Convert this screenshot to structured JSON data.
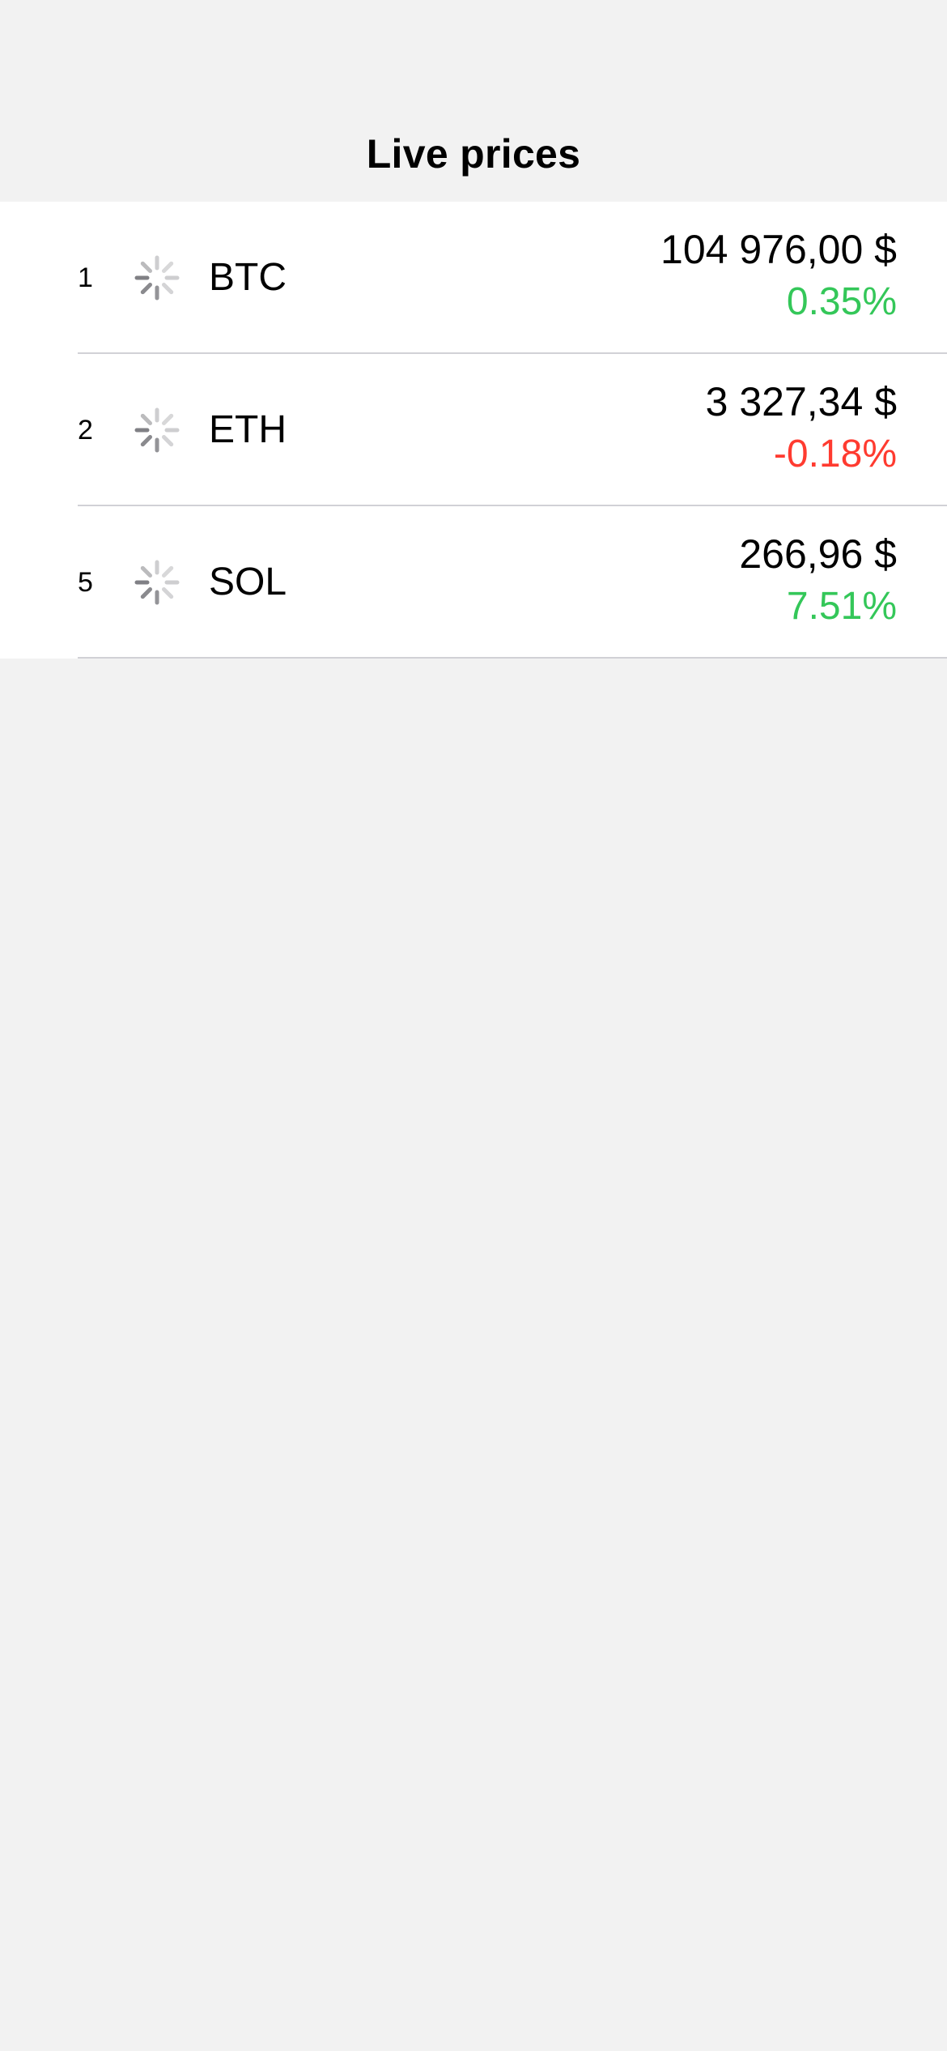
{
  "nav": {
    "title": "Live prices"
  },
  "colors": {
    "positive": "#34c759",
    "negative": "#ff3b30",
    "background": "#f2f2f2",
    "divider": "#d1d1d6"
  },
  "rows": [
    {
      "rank": "1",
      "icon": "loading-spinner-icon",
      "symbol": "BTC",
      "price": "104 976,00 $",
      "change": "0.35%",
      "trend": "up"
    },
    {
      "rank": "2",
      "icon": "loading-spinner-icon",
      "symbol": "ETH",
      "price": "3 327,34 $",
      "change": "-0.18%",
      "trend": "down"
    },
    {
      "rank": "5",
      "icon": "loading-spinner-icon",
      "symbol": "SOL",
      "price": "266,96 $",
      "change": "7.51%",
      "trend": "up"
    }
  ]
}
